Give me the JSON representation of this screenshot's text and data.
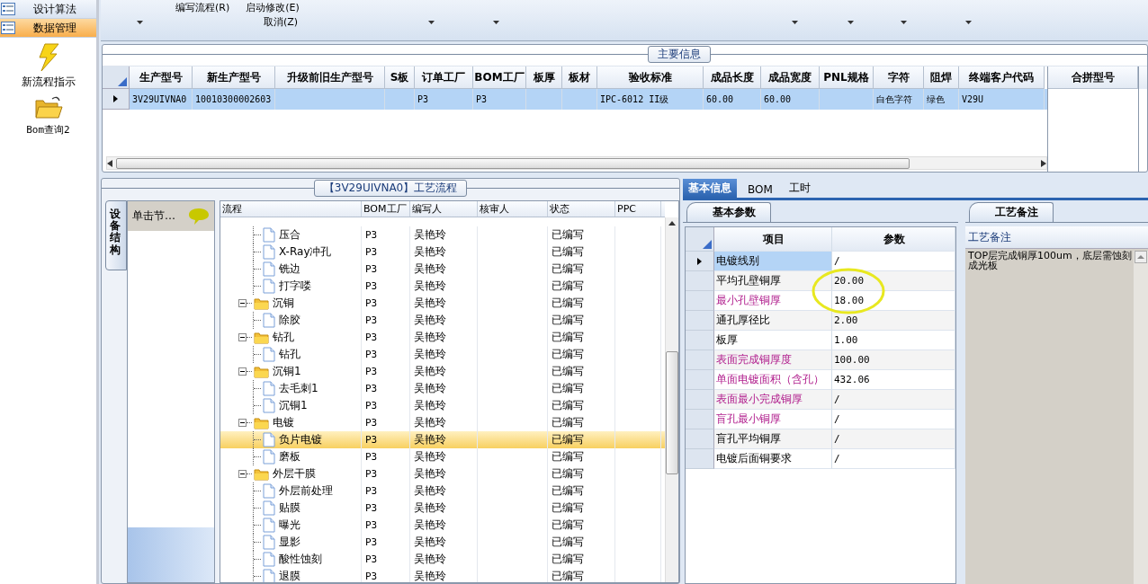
{
  "sidebar": {
    "items": [
      {
        "label": "设计算法",
        "selected": false
      },
      {
        "label": "数据管理",
        "selected": true
      }
    ],
    "shortcuts": [
      {
        "label": "新流程指示",
        "kind": "lightning"
      },
      {
        "label": "Bom查询2",
        "kind": "folder"
      }
    ]
  },
  "toolbar": {
    "commands": [
      "编写流程(R)",
      "启动修改(E)",
      "取消(Z)"
    ]
  },
  "main_info": {
    "title": "主要信息",
    "columns": [
      "生产型号",
      "新生产型号",
      "升级前旧生产型号",
      "S板",
      "订单工厂",
      "BOM工厂",
      "板厚",
      "板材",
      "验收标准",
      "成品长度",
      "成品宽度",
      "PNL规格",
      "字符",
      "阻焊",
      "终端客户代码"
    ],
    "rows": [
      {
        "selected": true,
        "cells": [
          "3V29UIVNA0",
          "10010300002603",
          "",
          "",
          "P3",
          "P3",
          "",
          "",
          "IPC-6012 II级",
          "60.00",
          "60.00",
          "",
          "白色字符",
          "绿色",
          "V29U"
        ]
      }
    ],
    "side_column": "合拼型号"
  },
  "process": {
    "title": "【3V29UIVNA0】工艺流程",
    "side_tab": "设备结构",
    "node_hint": "单击节…",
    "columns": [
      "流程",
      "BOM工厂",
      "编写人",
      "核审人",
      "状态",
      "PPC"
    ],
    "tree": [
      {
        "kind": "file",
        "name": "压合",
        "bom_factory": "P3",
        "writer": "吴艳玲",
        "status": "已编写",
        "selected": false
      },
      {
        "kind": "file",
        "name": "X-Ray冲孔",
        "bom_factory": "P3",
        "writer": "吴艳玲",
        "status": "已编写",
        "selected": false
      },
      {
        "kind": "file",
        "name": "铣边",
        "bom_factory": "P3",
        "writer": "吴艳玲",
        "status": "已编写",
        "selected": false
      },
      {
        "kind": "file",
        "name": "打字喽",
        "bom_factory": "P3",
        "writer": "吴艳玲",
        "status": "已编写",
        "selected": false
      },
      {
        "kind": "folder",
        "name": "沉铜",
        "bom_factory": "P3",
        "writer": "吴艳玲",
        "status": "已编写",
        "selected": false,
        "expanded": true,
        "children": [
          {
            "kind": "file",
            "name": "除胶",
            "bom_factory": "P3",
            "writer": "吴艳玲",
            "status": "已编写",
            "selected": false
          }
        ]
      },
      {
        "kind": "folder",
        "name": "钻孔",
        "bom_factory": "P3",
        "writer": "吴艳玲",
        "status": "已编写",
        "selected": false,
        "expanded": true,
        "children": [
          {
            "kind": "file",
            "name": "钻孔",
            "bom_factory": "P3",
            "writer": "吴艳玲",
            "status": "已编写",
            "selected": false
          }
        ]
      },
      {
        "kind": "folder",
        "name": "沉铜1",
        "bom_factory": "P3",
        "writer": "吴艳玲",
        "status": "已编写",
        "selected": false,
        "expanded": true,
        "children": [
          {
            "kind": "file",
            "name": "去毛刺1",
            "bom_factory": "P3",
            "writer": "吴艳玲",
            "status": "已编写",
            "selected": false
          },
          {
            "kind": "file",
            "name": "沉铜1",
            "bom_factory": "P3",
            "writer": "吴艳玲",
            "status": "已编写",
            "selected": false
          }
        ]
      },
      {
        "kind": "folder",
        "name": "电镀",
        "bom_factory": "P3",
        "writer": "吴艳玲",
        "status": "已编写",
        "selected": false,
        "expanded": true,
        "children": [
          {
            "kind": "file",
            "name": "负片电镀",
            "bom_factory": "P3",
            "writer": "吴艳玲",
            "status": "已编写",
            "selected": true
          },
          {
            "kind": "file",
            "name": "磨板",
            "bom_factory": "P3",
            "writer": "吴艳玲",
            "status": "已编写",
            "selected": false
          }
        ]
      },
      {
        "kind": "folder",
        "name": "外层干膜",
        "bom_factory": "P3",
        "writer": "吴艳玲",
        "status": "已编写",
        "selected": false,
        "expanded": true,
        "children": [
          {
            "kind": "file",
            "name": "外层前处理",
            "bom_factory": "P3",
            "writer": "吴艳玲",
            "status": "已编写",
            "selected": false
          },
          {
            "kind": "file",
            "name": "贴膜",
            "bom_factory": "P3",
            "writer": "吴艳玲",
            "status": "已编写",
            "selected": false
          },
          {
            "kind": "file",
            "name": "曝光",
            "bom_factory": "P3",
            "writer": "吴艳玲",
            "status": "已编写",
            "selected": false
          },
          {
            "kind": "file",
            "name": "显影",
            "bom_factory": "P3",
            "writer": "吴艳玲",
            "status": "已编写",
            "selected": false
          },
          {
            "kind": "file",
            "name": "酸性蚀刻",
            "bom_factory": "P3",
            "writer": "吴艳玲",
            "status": "已编写",
            "selected": false
          },
          {
            "kind": "file",
            "name": "退膜",
            "bom_factory": "P3",
            "writer": "吴艳玲",
            "status": "已编写",
            "selected": false
          }
        ]
      }
    ]
  },
  "details": {
    "tabs": [
      {
        "label": "基本信息",
        "selected": true
      },
      {
        "label": "BOM",
        "selected": false
      },
      {
        "label": "工时",
        "selected": false
      }
    ],
    "params_tab": "基本参数",
    "param_columns": [
      "项目",
      "参数"
    ],
    "params": [
      {
        "name": "电镀线别",
        "value": "/",
        "highlighted": false,
        "selected": true
      },
      {
        "name": "平均孔壁铜厚",
        "value": "20.00",
        "highlighted": false,
        "selected": false
      },
      {
        "name": "最小孔壁铜厚",
        "value": "18.00",
        "highlighted": true,
        "selected": false
      },
      {
        "name": "通孔厚径比",
        "value": "2.00",
        "highlighted": false,
        "selected": false
      },
      {
        "name": "板厚",
        "value": "1.00",
        "highlighted": false,
        "selected": false
      },
      {
        "name": "表面完成铜厚度",
        "value": "100.00",
        "highlighted": true,
        "selected": false
      },
      {
        "name": "单面电镀面积（含孔）",
        "value": "432.06",
        "highlighted": true,
        "selected": false
      },
      {
        "name": "表面最小完成铜厚",
        "value": "/",
        "highlighted": true,
        "selected": false
      },
      {
        "name": "盲孔最小铜厚",
        "value": "/",
        "highlighted": true,
        "selected": false
      },
      {
        "name": "盲孔平均铜厚",
        "value": "/",
        "highlighted": false,
        "selected": false
      },
      {
        "name": "电镀后面铜要求",
        "value": "/",
        "highlighted": false,
        "selected": false
      }
    ],
    "notes_tab": "工艺备注",
    "notes_label": "工艺备注",
    "notes": "TOP层完成铜厚100um，底层需蚀刻成光板"
  }
}
